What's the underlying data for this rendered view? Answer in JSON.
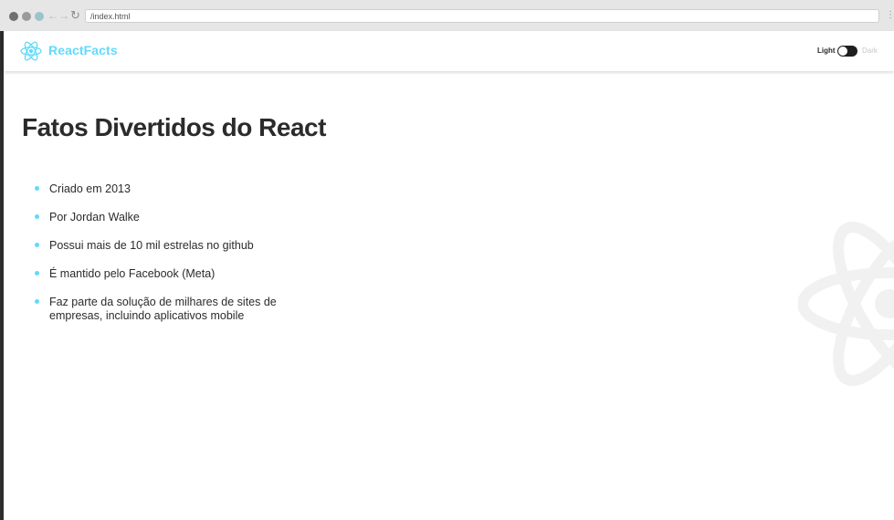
{
  "browser": {
    "url": "/index.html",
    "back_glyph": "←",
    "forward_glyph": "→",
    "reload_glyph": "↻",
    "menu_glyph": "⋮"
  },
  "navbar": {
    "logo_icon": "react-atom-icon",
    "brand": "ReactFacts",
    "toggle": {
      "light_label": "Light",
      "dark_label": "Dark",
      "state": "light"
    }
  },
  "main": {
    "title": "Fatos Divertidos do React",
    "facts": [
      "Criado em 2013",
      "Por Jordan Walke",
      "Possui mais de 10 mil estrelas no github",
      "É mantido pelo Facebook (Meta)",
      "Faz parte da solução de milhares de sites de empresas, incluindo aplicativos mobile"
    ],
    "background_icon": "react-atom-icon"
  },
  "colors": {
    "accent": "#61dafb",
    "text": "#2b2b2b",
    "toggle_track": "#1f1f1f"
  }
}
